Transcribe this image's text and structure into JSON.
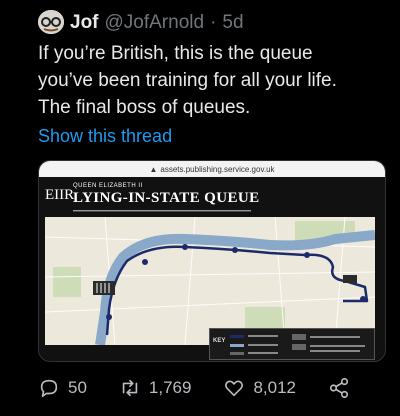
{
  "tweet": {
    "display_name": "Jof",
    "handle": "@JofArnold",
    "separator": "·",
    "timestamp": "5d",
    "body_lines": [
      "If you’re British, this is the queue",
      "you’ve been training for all your life.",
      "The final boss of queues."
    ],
    "show_thread": "Show this thread"
  },
  "media": {
    "url": "assets.publishing.service.gov.uk",
    "kicker": "QUEEN ELIZABETH II",
    "title": "LYING-IN-STATE QUEUE",
    "crest": "EIIR",
    "key_label": "KEY"
  },
  "actions": {
    "replies": "50",
    "retweets": "1,769",
    "likes": "8,012"
  },
  "colors": {
    "background": "#000000",
    "text": "#e7e9ea",
    "muted": "#71767b",
    "link": "#1d9bf0",
    "river": "#8aa9c9",
    "route": "#1c2a6b"
  }
}
